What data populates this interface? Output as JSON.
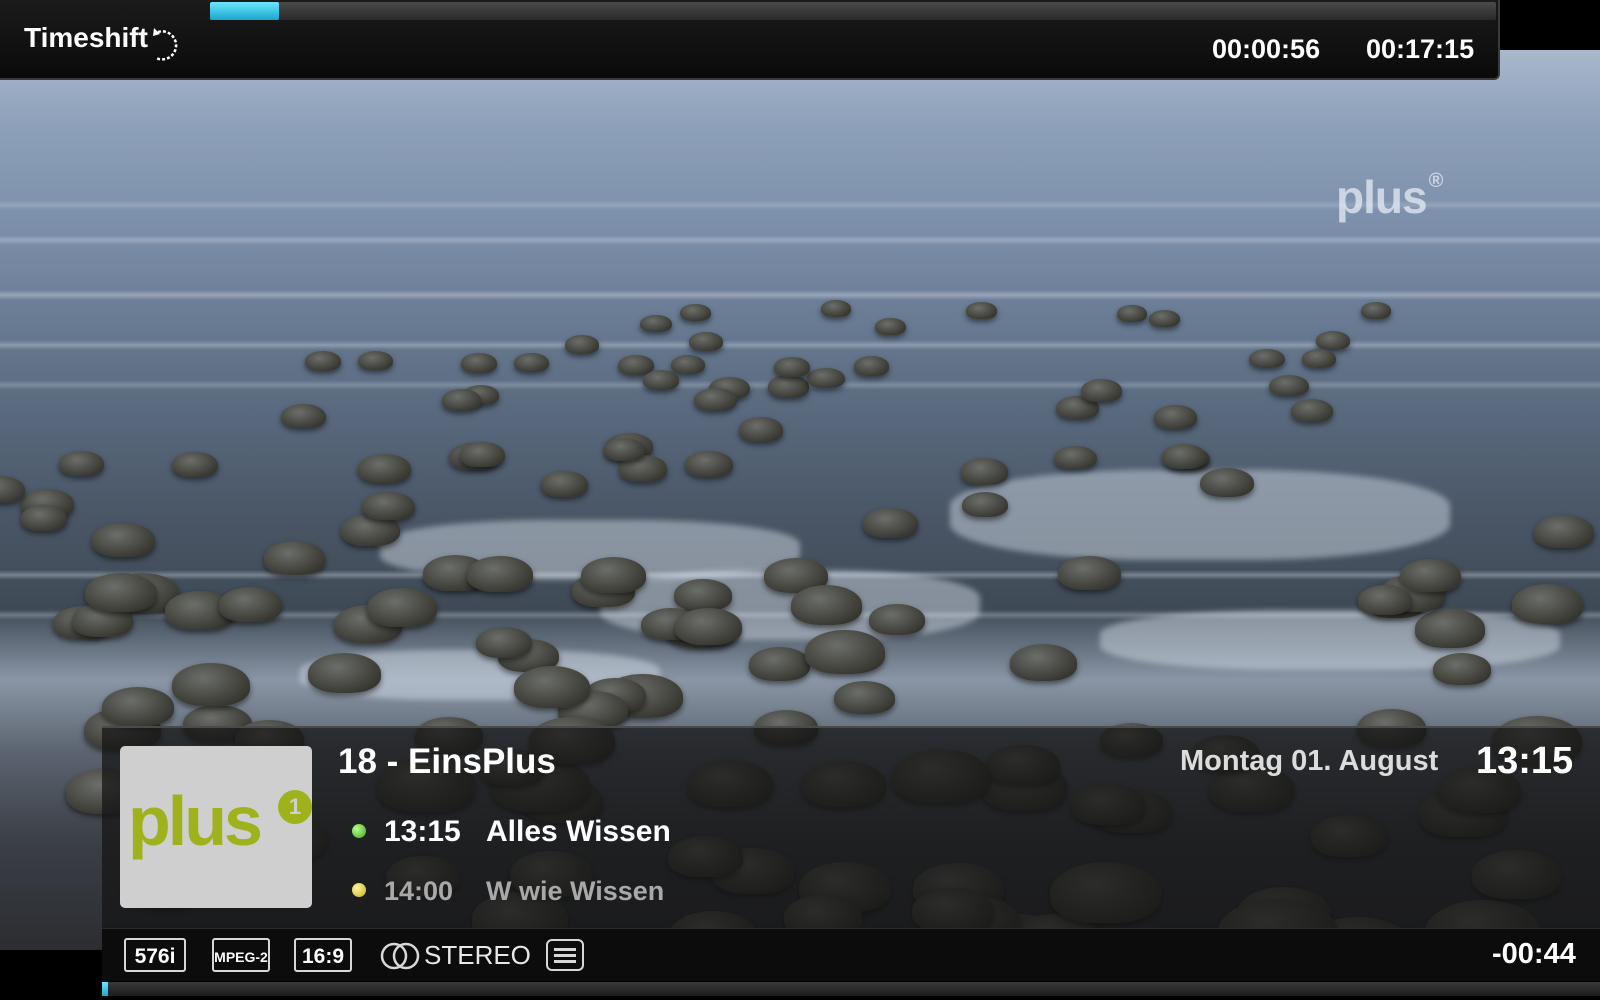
{
  "video": {
    "watermark": "plus",
    "watermark_reg": "®"
  },
  "timeshift": {
    "title": "Timeshift",
    "elapsed": "00:00:56",
    "total": "00:17:15",
    "progress_fraction": 0.054,
    "accent_color": "#2ab8dd"
  },
  "infobar": {
    "logo_text": "plus",
    "logo_reg": "1",
    "channel": "18 - EinsPlus",
    "date": "Montag 01. August",
    "clock": "13:15",
    "now": {
      "time": "13:15",
      "title": "Alles Wissen",
      "dot_color": "green"
    },
    "next": {
      "time": "14:00",
      "title": "W wie Wissen",
      "dot_color": "yellow"
    }
  },
  "status": {
    "resolution": "576i",
    "codec": "MPEG-2",
    "aspect": "16:9",
    "audio": "STEREO",
    "teletext_icon": "teletext-icon",
    "remaining": "-00:44",
    "event_progress_fraction": 0.004
  }
}
